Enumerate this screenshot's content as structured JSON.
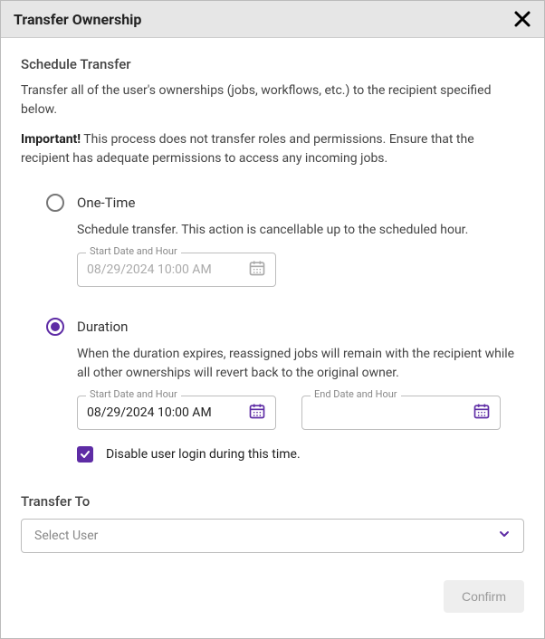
{
  "header": {
    "title": "Transfer Ownership"
  },
  "schedule": {
    "title": "Schedule Transfer",
    "desc1": "Transfer all of the user's ownerships (jobs, workflows, etc.) to the recipient specified below.",
    "importantLabel": "Important!",
    "desc2": " This process does not transfer roles and permissions. Ensure that the recipient has adequate permissions to access any incoming jobs."
  },
  "oneTime": {
    "label": "One-Time",
    "desc": "Schedule transfer. This action is cancellable up to the scheduled hour.",
    "start": {
      "label": "Start Date and Hour",
      "value": "08/29/2024 10:00 AM"
    }
  },
  "duration": {
    "label": "Duration",
    "desc": "When the duration expires, reassigned jobs will remain with the recipient while all other ownerships will revert back to the original owner.",
    "start": {
      "label": "Start Date and Hour",
      "value": "08/29/2024 10:00 AM"
    },
    "end": {
      "label": "End Date and Hour",
      "value": ""
    },
    "disableLogin": "Disable user login during this time."
  },
  "transferTo": {
    "label": "Transfer To",
    "placeholder": "Select User"
  },
  "footer": {
    "confirm": "Confirm"
  },
  "colors": {
    "accent": "#5e2ca5"
  }
}
